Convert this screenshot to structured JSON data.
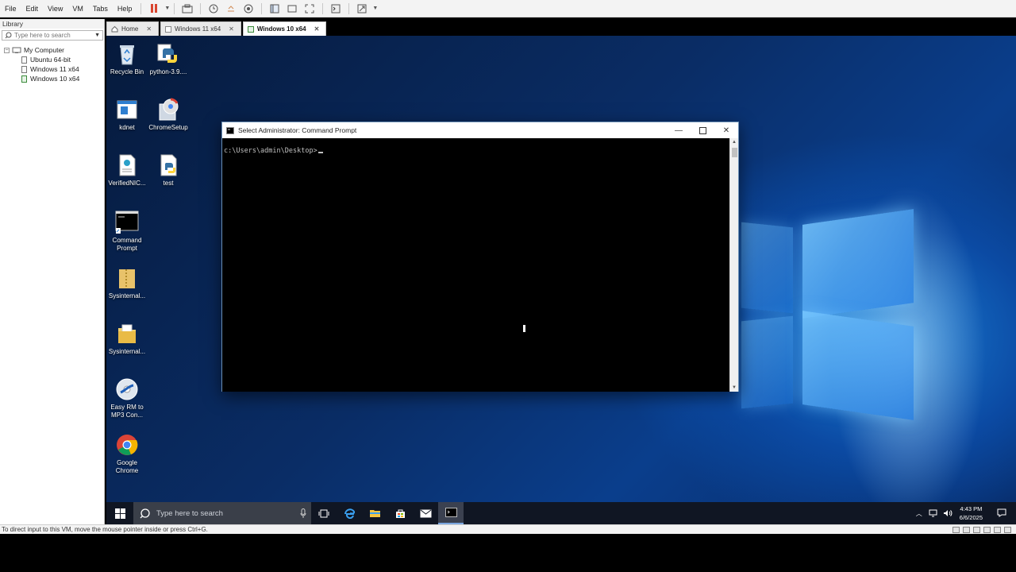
{
  "host": {
    "menu": [
      "File",
      "Edit",
      "View",
      "VM",
      "Tabs",
      "Help"
    ],
    "library": {
      "title": "Library",
      "search_placeholder": "Type here to search",
      "tree": {
        "root": "My Computer",
        "items": [
          "Ubuntu 64-bit",
          "Windows 11 x64",
          "Windows 10 x64"
        ]
      }
    },
    "tabs": [
      {
        "label": "Home"
      },
      {
        "label": "Windows 11 x64"
      },
      {
        "label": "Windows 10 x64",
        "active": true
      }
    ],
    "status_text": "To direct input to this VM, move the mouse pointer inside or press Ctrl+G."
  },
  "guest": {
    "desktop_icons": {
      "recycle_bin": "Recycle Bin",
      "python": "python-3.9....",
      "kdnet": "kdnet",
      "chromesetup": "ChromeSetup",
      "verified": "VerifiedNIC...",
      "test": "test",
      "cmd1": "Command",
      "cmd2": "Prompt",
      "sys1": "Sysinternal...",
      "sys2": "Sysinternal...",
      "easy1": "Easy RM to",
      "easy2": "MP3 Con...",
      "chrome1": "Google",
      "chrome2": "Chrome"
    },
    "console": {
      "title": "Select Administrator: Command Prompt",
      "prompt": "c:\\Users\\admin\\Desktop>"
    },
    "taskbar": {
      "search_placeholder": "Type here to search",
      "time": "4:43 PM",
      "date": "6/6/2025"
    }
  },
  "colors": {
    "accent": "#0b4aa3",
    "taskbar": "#101623",
    "pause": "#d9452f"
  }
}
